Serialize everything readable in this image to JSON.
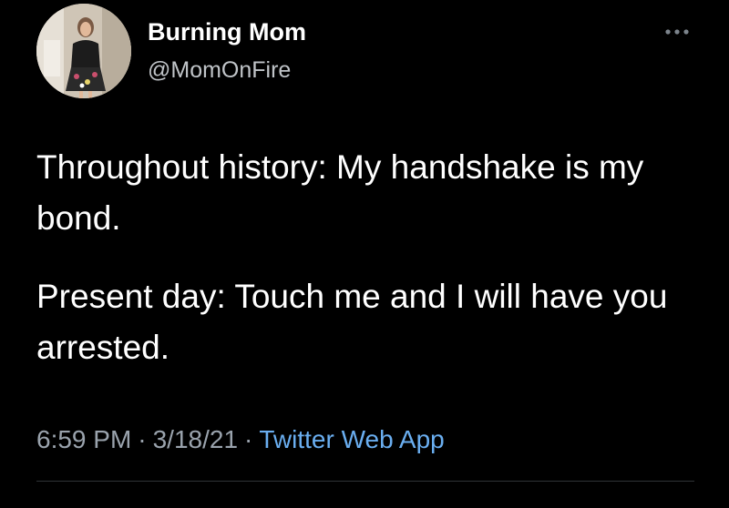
{
  "tweet": {
    "author": {
      "display_name": "Burning Mom",
      "handle": "@MomOnFire"
    },
    "text_paragraphs": [
      "Throughout history: My handshake is my bond.",
      "Present day: Touch me and I will have you arrested."
    ],
    "time": "6:59 PM",
    "date": "3/18/21",
    "separator": "·",
    "source": "Twitter Web App"
  },
  "icons": {
    "more": "more-options-icon"
  },
  "colors": {
    "background": "#000000",
    "text": "#ffffff",
    "handle": "#c0c4c8",
    "meta": "#9aa3ad",
    "link": "#6aaef0",
    "divider": "#2f3336"
  }
}
